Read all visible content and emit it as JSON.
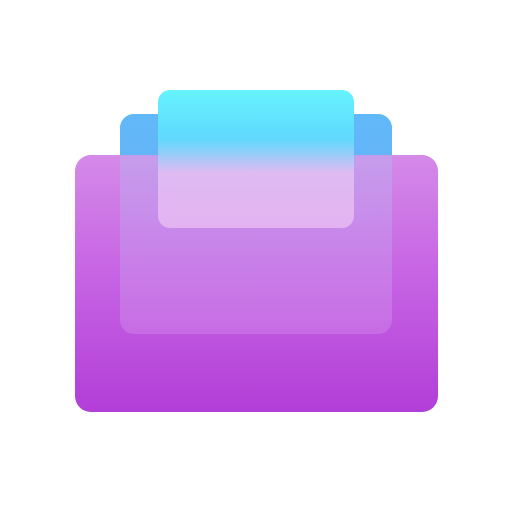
{
  "icon": {
    "name": "stacked-cards-app-icon",
    "colors": {
      "background": "#ffffff",
      "front_top": "#d48ae8",
      "front_mid": "#c765e4",
      "front_bottom": "#b23ed8",
      "middle": "#3fb0fb",
      "back_top": "#66f3fe",
      "back_bottom": "#e3b3f1"
    }
  }
}
